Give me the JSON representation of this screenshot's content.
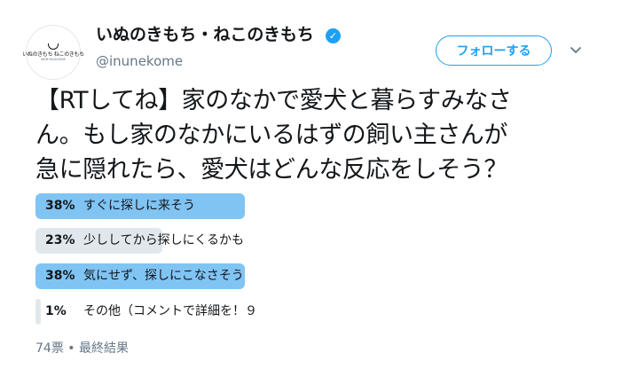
{
  "account": {
    "display_name": "いぬのきもち・ねこのきもち",
    "handle": "@inunekome",
    "verified": true,
    "avatar_logo_jp": "いぬのきもち ねこのきもち",
    "avatar_logo_en": "WEB MAGAZINE"
  },
  "follow_button": {
    "label": "フォローする"
  },
  "tweet": {
    "text": "【RTしてね】家のなかで愛犬と暮らすみなさ\nん。もし家のなかにいるはずの飼い主さんが\n急に隠れたら、愛犬はどんな反応をしそう？"
  },
  "poll": {
    "options": [
      {
        "percent_label": "38%",
        "percent": 38,
        "label": "すぐに探しに来そう",
        "leading": true
      },
      {
        "percent_label": "23%",
        "percent": 23,
        "label": "少ししてから探しにくるかも",
        "leading": false
      },
      {
        "percent_label": "38%",
        "percent": 38,
        "label": "気にせず、探しにこなさそう",
        "leading": true
      },
      {
        "percent_label": "1%",
        "percent": 1,
        "label": "その他（コメントで詳細を！９",
        "leading": false
      }
    ],
    "summary": "74票 • 最終結果"
  },
  "colors": {
    "accent": "#1da1f2",
    "leading_bar": "#80c4f4",
    "other_bar": "#e1e8ed",
    "text": "#14171a",
    "muted": "#657786"
  }
}
